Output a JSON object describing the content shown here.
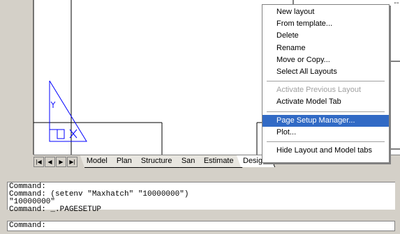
{
  "tabbar": {
    "nav_icons": [
      "first-tab-icon",
      "prev-tab-icon",
      "next-tab-icon",
      "last-tab-icon"
    ],
    "tabs": [
      {
        "label": "Model",
        "active": false
      },
      {
        "label": "Plan",
        "active": false
      },
      {
        "label": "Structure",
        "active": false
      },
      {
        "label": "San",
        "active": false
      },
      {
        "label": "Estimate",
        "active": false
      },
      {
        "label": "Design",
        "active": true
      }
    ]
  },
  "context_menu": {
    "items": [
      {
        "label": "New layout"
      },
      {
        "label": "From template..."
      },
      {
        "label": "Delete"
      },
      {
        "label": "Rename"
      },
      {
        "label": "Move or Copy..."
      },
      {
        "label": "Select All Layouts"
      },
      {
        "label": "Activate Previous Layout",
        "disabled": true
      },
      {
        "label": "Activate Model Tab"
      },
      {
        "label": "Page Setup Manager...",
        "selected": true
      },
      {
        "label": "Plot..."
      },
      {
        "label": "Hide Layout and Model tabs"
      }
    ]
  },
  "command_window": {
    "history": [
      "Command:",
      "Command: (setenv \"Maxhatch\" \"10000000\")",
      "\"10000000\"",
      "Command: _.PAGESETUP"
    ],
    "prompt": "Command:"
  },
  "colors": {
    "selection": "#316ac5",
    "drawing": "#0000ff",
    "ui_face": "#d4d0c8"
  }
}
